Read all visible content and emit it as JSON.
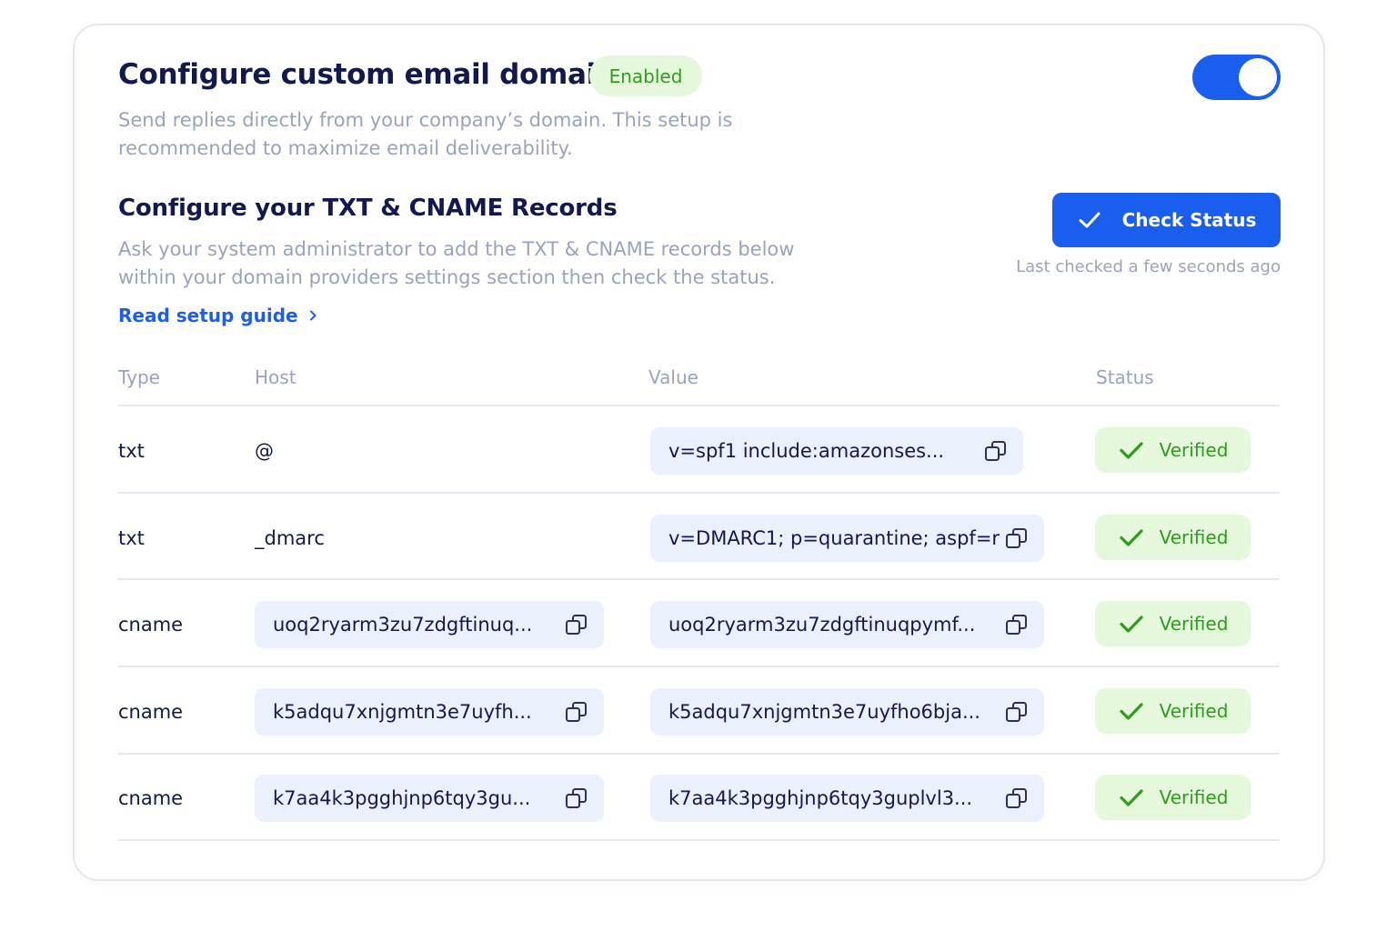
{
  "header": {
    "title": "Configure custom email domain",
    "badge": "Enabled",
    "description": "Send replies directly from your company’s domain. This setup is recommended to maximize email deliverability."
  },
  "records_section": {
    "title": "Configure your TXT & CNAME Records",
    "description": "Ask your system administrator to add the TXT & CNAME records below within your domain providers settings section then check the status.",
    "guide_link": "Read setup guide",
    "check_button": "Check Status",
    "last_checked": "Last checked a few seconds ago"
  },
  "table": {
    "headers": [
      "Type",
      "Host",
      "Value",
      "Status"
    ],
    "rows": [
      {
        "type": "txt",
        "host": "@",
        "host_copyable": false,
        "value": "v=spf1 include:amazonses...",
        "status": "Verified"
      },
      {
        "type": "txt",
        "host": "_dmarc",
        "host_copyable": false,
        "value": "v=DMARC1; p=quarantine; aspf=r",
        "status": "Verified"
      },
      {
        "type": "cname",
        "host": "uoq2ryarm3zu7zdgftinuq...",
        "host_copyable": true,
        "value": "uoq2ryarm3zu7zdgftinuqpymf...",
        "status": "Verified"
      },
      {
        "type": "cname",
        "host": "k5adqu7xnjgmtn3e7uyfh...",
        "host_copyable": true,
        "value": "k5adqu7xnjgmtn3e7uyfho6bja...",
        "status": "Verified"
      },
      {
        "type": "cname",
        "host": "k7aa4k3pgghjnp6tqy3gu...",
        "host_copyable": true,
        "value": "k7aa4k3pgghjnp6tqy3guplvl3...",
        "status": "Verified"
      }
    ]
  },
  "colors": {
    "primary": "#1a5ef0",
    "success_bg": "#e5f8db",
    "success_text": "#2f9c1e",
    "pill_bg": "#ebf0fd"
  },
  "icons": {
    "toggle": "toggle-switch",
    "check": "check-icon",
    "chevron": "chevron-right-icon",
    "copy": "copy-icon"
  }
}
